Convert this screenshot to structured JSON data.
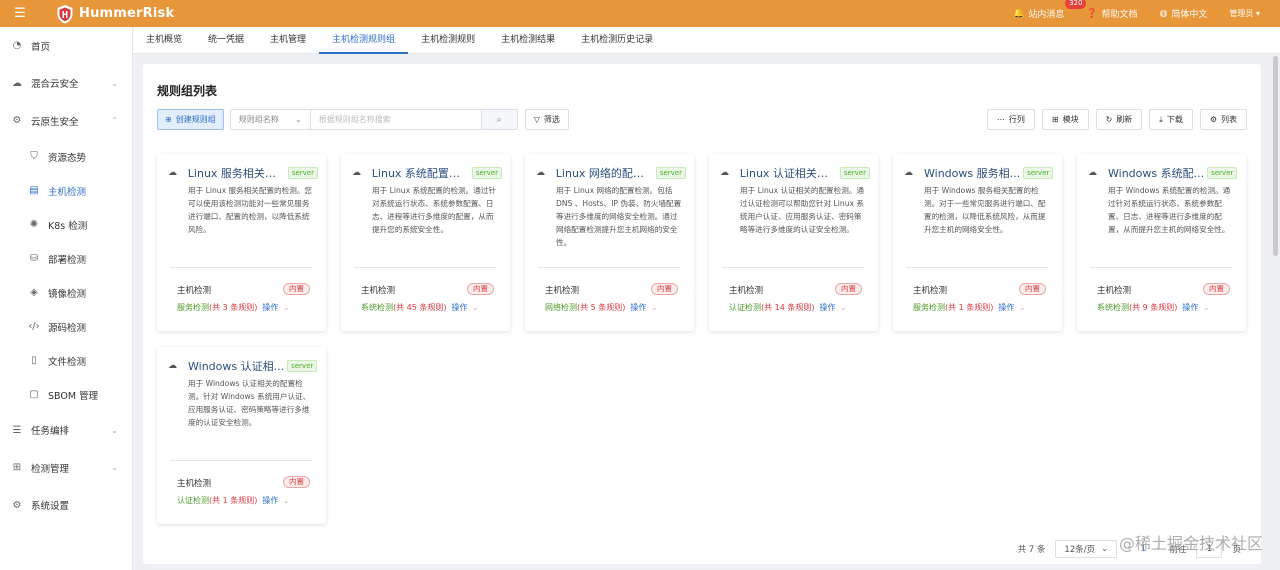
{
  "header": {
    "app_name": "HummerRisk",
    "messages_label": "站内消息",
    "messages_badge": "320",
    "help_label": "帮助文档",
    "lang_label": "简体中文",
    "user_label": "管理员 ▾",
    "brand_color": "#e8963a"
  },
  "sidebar": {
    "items": [
      {
        "label": "首页",
        "icon": "home-icon"
      },
      {
        "label": "混合云安全",
        "icon": "cloud-icon"
      },
      {
        "label": "云原生安全",
        "icon": "cluster-icon"
      },
      {
        "label": "资源态势",
        "icon": "shield-icon"
      },
      {
        "label": "主机检测",
        "icon": "host-icon"
      },
      {
        "label": "K8s 检测",
        "icon": "k8s-icon"
      },
      {
        "label": "部署检测",
        "icon": "deploy-icon"
      },
      {
        "label": "镜像检测",
        "icon": "image-icon"
      },
      {
        "label": "源码检测",
        "icon": "code-icon"
      },
      {
        "label": "文件检测",
        "icon": "file-icon"
      },
      {
        "label": "SBOM 管理",
        "icon": "sbom-icon"
      },
      {
        "label": "任务编排",
        "icon": "task-icon"
      },
      {
        "label": "检测管理",
        "icon": "manage-icon"
      },
      {
        "label": "系统设置",
        "icon": "gear-icon"
      }
    ]
  },
  "tabs": [
    {
      "label": "主机概览"
    },
    {
      "label": "统一凭据"
    },
    {
      "label": "主机管理"
    },
    {
      "label": "主机检测规则组"
    },
    {
      "label": "主机检测规则"
    },
    {
      "label": "主机检测结果"
    },
    {
      "label": "主机检测历史记录"
    }
  ],
  "main": {
    "title": "规则组列表",
    "create_label": "创建规则组",
    "search_field": "规则组名称",
    "search_placeholder": "根据规则组名称搜索",
    "filter_label": "筛选",
    "tools": [
      {
        "label": "行列",
        "icon": "columns-icon"
      },
      {
        "label": "模块",
        "icon": "grid-icon"
      },
      {
        "label": "刷新",
        "icon": "refresh-icon"
      },
      {
        "label": "下载",
        "icon": "download-icon"
      },
      {
        "label": "列表",
        "icon": "list-icon"
      }
    ]
  },
  "cards": [
    {
      "title": "Linux 服务相关配...",
      "tag": "server",
      "desc": "用于 Linux 服务相关配置的检测。您可以使用该检测功能对一些常见服务进行端口、配置的检测，以降低系统风险。",
      "category": "主机检测",
      "builtin": "内置",
      "rule_type": "服务检测",
      "rule_count": " (共 3 条规则)",
      "op": "操作"
    },
    {
      "title": "Linux 系统配置的...",
      "tag": "server",
      "desc": "用于 Linux 系统配置的检测。通过针对系统运行状态、系统参数配置、日志、进程等进行多维度的配置，从而提升您的系统安全性。",
      "category": "主机检测",
      "builtin": "内置",
      "rule_type": "系统检测",
      "rule_count": " (共 45 条规则)",
      "op": "操作"
    },
    {
      "title": "Linux 网络的配置...",
      "tag": "server",
      "desc": "用于 Linux 网络的配置检测。包括 DNS 、Hosts、IP 伪装、防火墙配置等进行多维度的网络安全检测。通过网络配置检测提升您主机网络的安全性。",
      "category": "主机检测",
      "builtin": "内置",
      "rule_type": "网络检测",
      "rule_count": " (共 5 条规则)",
      "op": "操作"
    },
    {
      "title": "Linux 认证相关的...",
      "tag": "server",
      "desc": "用于 Linux 认证相关的配置检测。通过认证检测可以帮助您针对 Linux 系统用户认证、应用服务认证、密码策略等进行多维度的认证安全检测。",
      "category": "主机检测",
      "builtin": "内置",
      "rule_type": "认证检测",
      "rule_count": " (共 14 条规则)",
      "op": "操作"
    },
    {
      "title": "Windows 服务相...",
      "tag": "server",
      "desc": "用于 Windows 服务相关配置的检测。对于一些常见服务进行端口、配置的检测，以降低系统风险，从而提升您主机的网络安全性。",
      "category": "主机检测",
      "builtin": "内置",
      "rule_type": "服务检测",
      "rule_count": " (共 1 条规则)",
      "op": "操作"
    },
    {
      "title": "Windows 系统配...",
      "tag": "server",
      "desc": "用于 Windows 系统配置的检测。通过针对系统运行状态、系统参数配置、日志、进程等进行多维度的配置，从而提升您主机的网络安全性。",
      "category": "主机检测",
      "builtin": "内置",
      "rule_type": "系统检测",
      "rule_count": " (共 9 条规则)",
      "op": "操作"
    },
    {
      "title": "Windows 认证相...",
      "tag": "server",
      "desc": "用于 Windows 认证相关的配置检测。针对 Windows 系统用户认证、应用服务认证、密码策略等进行多维度的认证安全检测。",
      "category": "主机检测",
      "builtin": "内置",
      "rule_type": "认证检测",
      "rule_count": " (共 1 条规则)",
      "op": "操作"
    }
  ],
  "pagination": {
    "total": "共 7 条",
    "page_size": "12条/页",
    "current": "1",
    "goto_label": "前往",
    "goto_value": "1",
    "page_suffix": "页"
  },
  "watermark": "@稀土掘金技术社区"
}
